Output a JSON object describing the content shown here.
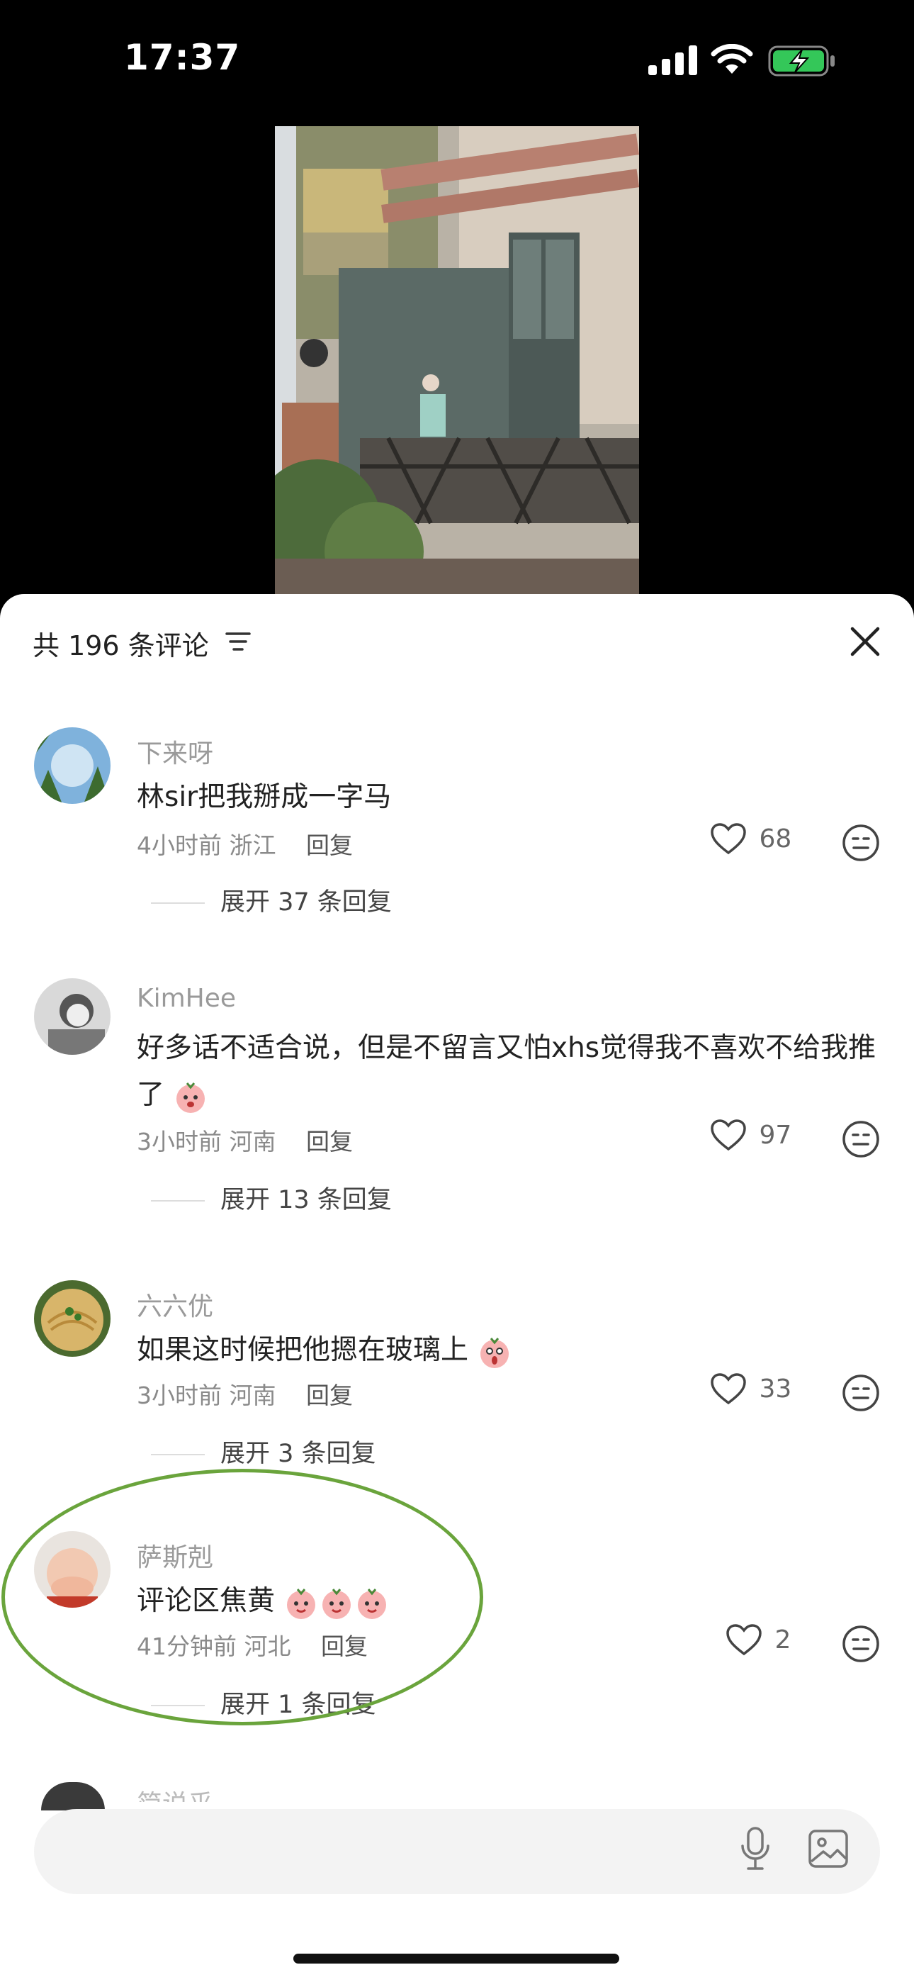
{
  "status_bar": {
    "time": "17:37"
  },
  "sheet": {
    "title": "共 196 条评论"
  },
  "comments": [
    {
      "username": "下来呀",
      "text": "林sir把我掰成一字马",
      "time": "4小时前",
      "location": "浙江",
      "reply_label": "回复",
      "likes": "68",
      "expand_label": "展开 37 条回复"
    },
    {
      "username": "KimHee",
      "text": "好多话不适合说，但是不留言又怕xhs觉得我不喜欢不给我推了",
      "time": "3小时前",
      "location": "河南",
      "reply_label": "回复",
      "likes": "97",
      "expand_label": "展开 13 条回复"
    },
    {
      "username": "六六优",
      "text": "如果这时候把他摁在玻璃上",
      "time": "3小时前",
      "location": "河南",
      "reply_label": "回复",
      "likes": "33",
      "expand_label": "展开 3 条回复"
    },
    {
      "username": "萨斯剋",
      "text": "评论区焦黄",
      "time": "41分钟前",
      "location": "河北",
      "reply_label": "回复",
      "likes": "2",
      "expand_label": "展开 1 条回复"
    }
  ],
  "next_username_partial": "简说乎",
  "colors": {
    "accent_circle": "#6aa43c",
    "sheet_bg": "#ffffff",
    "page_bg": "#000000"
  },
  "icons": [
    "signal-icon",
    "wifi-icon",
    "battery-charging-icon",
    "filter-icon",
    "close-icon",
    "heart-icon",
    "emoji-face-icon",
    "microphone-icon",
    "image-icon"
  ]
}
